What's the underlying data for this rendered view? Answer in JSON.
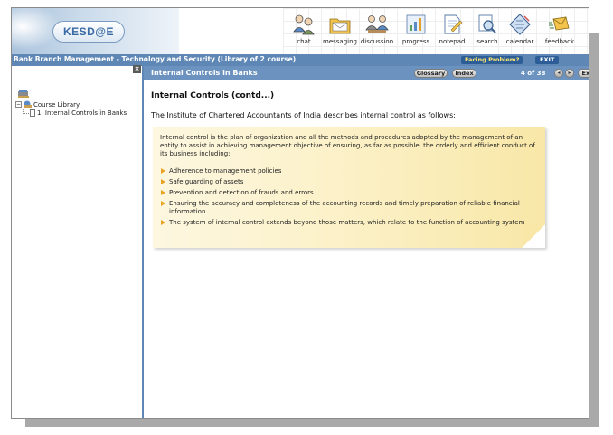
{
  "brand": {
    "logo_text": "KESD@E"
  },
  "toolbar": {
    "items": [
      {
        "id": "chat",
        "label": "chat"
      },
      {
        "id": "messaging",
        "label": "messaging"
      },
      {
        "id": "discussion",
        "label": "discussion"
      },
      {
        "id": "progress",
        "label": "progress"
      },
      {
        "id": "notepad",
        "label": "notepad"
      },
      {
        "id": "search",
        "label": "search"
      },
      {
        "id": "calendar",
        "label": "calendar"
      },
      {
        "id": "feedback",
        "label": "feedback"
      }
    ]
  },
  "titlebar": {
    "course_title": "Bank Branch Management - Technology and Security (Library of 2 course)",
    "facing_problem": "Facing Problem?",
    "exit": "EXIT"
  },
  "sidebar": {
    "close_label": "×",
    "root_label": "Course Library",
    "items": [
      {
        "label": "1. Internal Controls in Banks"
      }
    ]
  },
  "content_header": {
    "title": "Internal Controls in Banks",
    "glossary": "Glossary",
    "index": "Index",
    "page_count": "4 of 38",
    "prev_glyph": "◂",
    "next_glyph": "▸",
    "exit": "Exit"
  },
  "content": {
    "heading": "Internal Controls (contd...)",
    "intro": "The Institute of Chartered Accountants of India describes internal control as follows:",
    "note": {
      "paragraph": "Internal control is the plan of organization and all the methods and procedures adopted by the management of an entity to assist in achieving management objective of ensuring, as far as possible, the orderly and efficient conduct of its business including:",
      "bullets": [
        "Adherence to management policies",
        "Safe guarding of assets",
        "Prevention and detection of frauds and errors",
        "Ensuring the accuracy and completeness of the accounting records and timely preparation of reliable financial information",
        "The system of internal control extends beyond those matters, which relate to the function of accounting system"
      ]
    }
  },
  "colors": {
    "titlebar_bg": "#5f87b5",
    "header_bg": "#6c93bf",
    "note_bg": "#fbefc1",
    "bullet": "#e9a323"
  }
}
